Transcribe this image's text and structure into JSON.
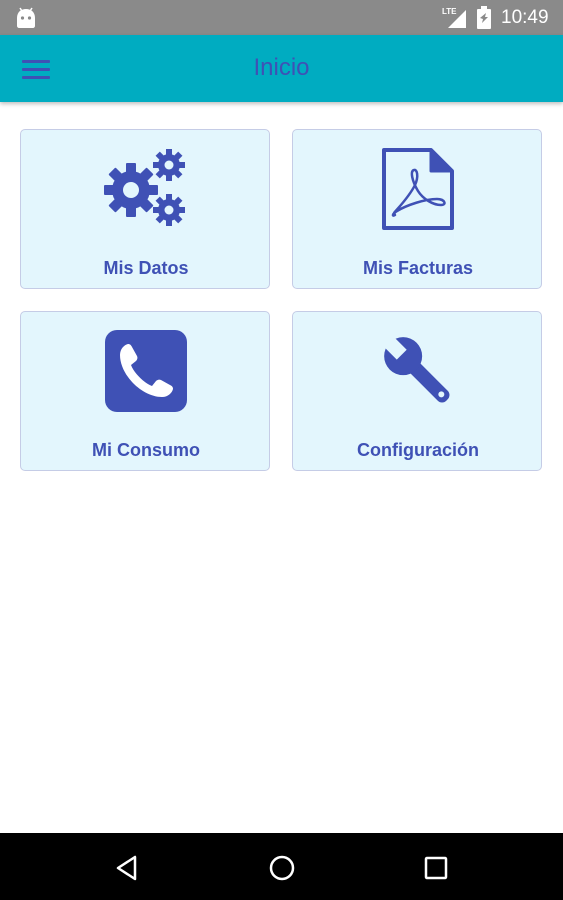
{
  "status_bar": {
    "network_label": "LTE",
    "time": "10:49",
    "icons": [
      "android-icon",
      "signal-icon",
      "battery-icon"
    ]
  },
  "app_bar": {
    "title": "Inicio",
    "menu_icon": "hamburger-menu-icon"
  },
  "tiles": [
    {
      "label": "Mis Datos",
      "icon": "gears-icon"
    },
    {
      "label": "Mis Facturas",
      "icon": "pdf-document-icon"
    },
    {
      "label": "Mi Consumo",
      "icon": "phone-icon"
    },
    {
      "label": "Configuración",
      "icon": "wrench-icon"
    }
  ],
  "nav_bar": {
    "buttons": [
      "back-icon",
      "home-icon",
      "recent-apps-icon"
    ]
  },
  "colors": {
    "status_bar": "#8a8a8a",
    "app_bar": "#00acc1",
    "accent": "#3f51b5",
    "tile_background": "#e3f6fd",
    "tile_border": "#c5cce6",
    "nav_bar": "#000000"
  }
}
